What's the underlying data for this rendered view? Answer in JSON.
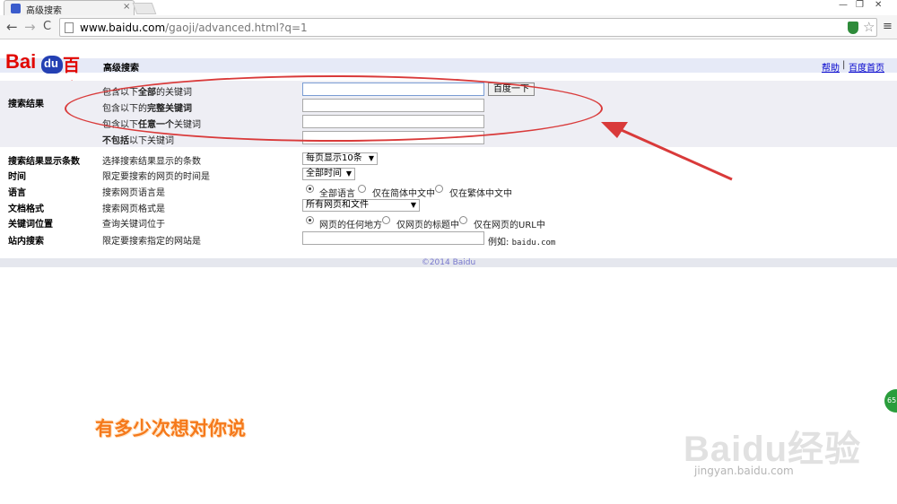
{
  "browser": {
    "tab_title": "高级搜索",
    "tab_close": "×",
    "url_host": "www.baidu.com",
    "url_path": "/gaoji/advanced.html?q=1",
    "back_icon": "←",
    "forward_icon": "→",
    "reload_icon": "C",
    "star_icon": "☆",
    "menu_icon": "≡",
    "minimize": "—",
    "restore": "❐",
    "close": "✕"
  },
  "page": {
    "logo": {
      "bai": "Bai",
      "du": "du",
      "baidu_cn": "百度"
    },
    "title": "高级搜索",
    "help_link": "帮助",
    "separator": "|",
    "home_link": "百度首页",
    "section_label": "搜索结果",
    "keyword_rows": [
      {
        "prefix": "包含以下",
        "bold": "全部",
        "suffix": "的关键词"
      },
      {
        "prefix": "包含以下的",
        "bold": "完整关键词",
        "suffix": ""
      },
      {
        "prefix": "包含以下",
        "bold": "任意一个",
        "suffix": "关键词"
      },
      {
        "prefix": "",
        "bold": "不包括",
        "suffix": "以下关键词"
      }
    ],
    "search_button": "百度一下",
    "options": [
      {
        "label": "搜索结果显示条数",
        "desc": "选择搜索结果显示的条数",
        "select": "每页显示10条"
      },
      {
        "label": "时间",
        "desc": "限定要搜索的网页的时间是",
        "select": "全部时间"
      },
      {
        "label": "语言",
        "desc": "搜索网页语言是",
        "radios": [
          "全部语言",
          "仅在简体中文中",
          "仅在繁体中文中"
        ]
      },
      {
        "label": "文档格式",
        "desc": "搜索网页格式是",
        "select": "所有网页和文件"
      },
      {
        "label": "关键词位置",
        "desc": "查询关键词位于",
        "radios": [
          "网页的任何地方",
          "仅网页的标题中",
          "仅在网页的URL中"
        ]
      },
      {
        "label": "站内搜索",
        "desc": "限定要搜索指定的网站是"
      }
    ],
    "site_example_label": "例如:",
    "site_example_value": "baidu.com",
    "copyright": "©2014 Baidu"
  },
  "overlay": {
    "subtitle": "有多少次想对你说",
    "watermark": "Baidu经验",
    "watermark_url": "jingyan.baidu.com",
    "badge": "65"
  },
  "colors": {
    "accent_red": "#e10601",
    "baidu_blue": "#2440b3",
    "annotation": "#d93a3a",
    "subtitle": "#f5791b"
  }
}
